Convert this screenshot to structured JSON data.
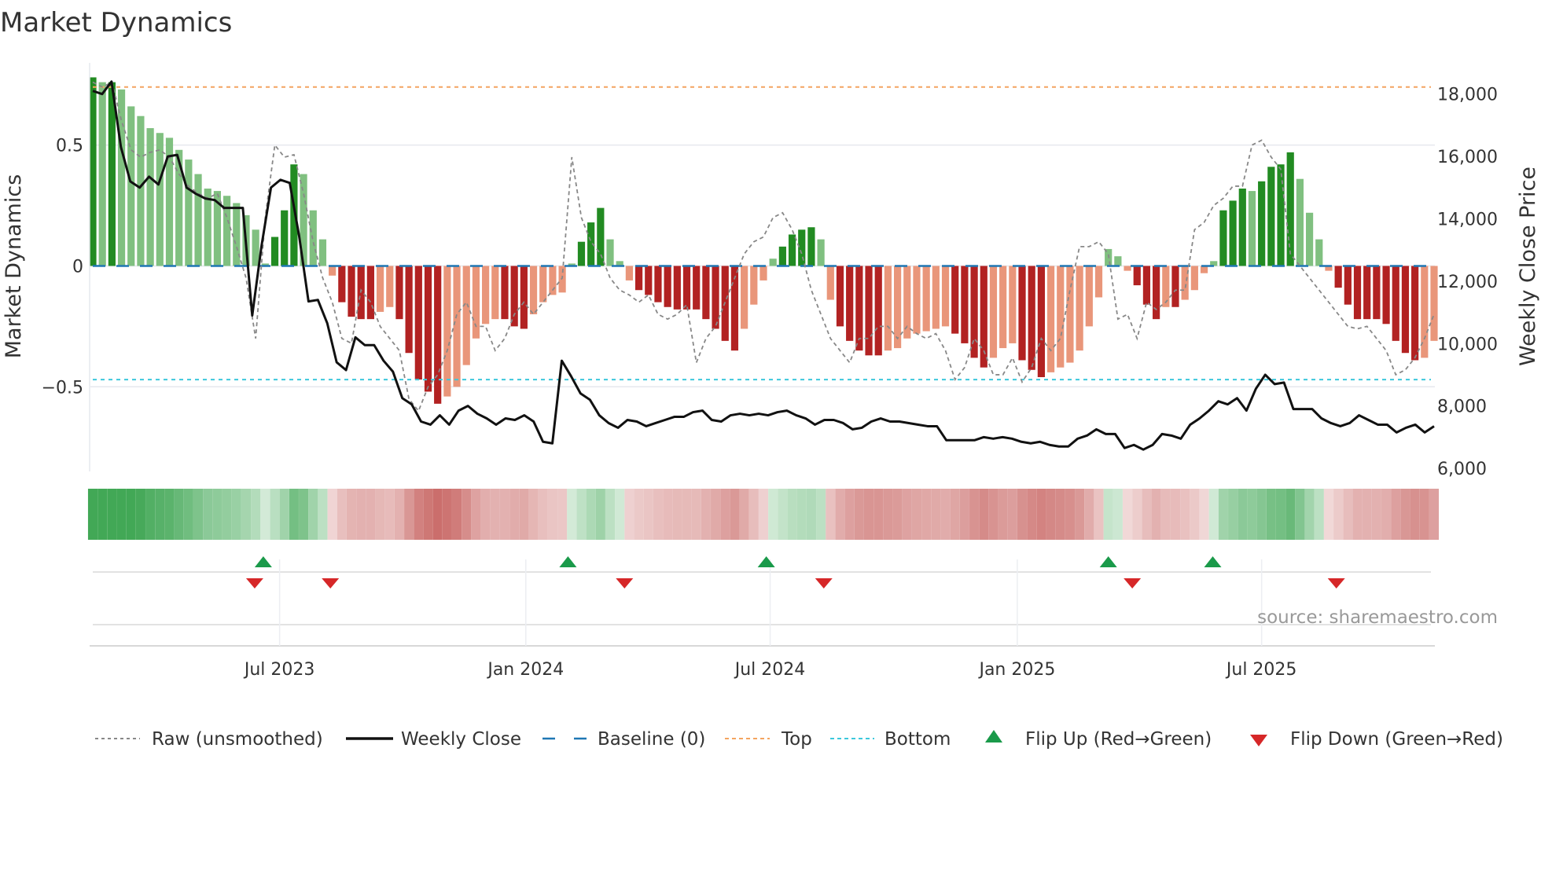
{
  "chart_data": {
    "type": "bar",
    "title": "Market Dynamics",
    "ylabel_left": "Market Dynamics",
    "ylabel_right": "Weekly Close Price",
    "ylim_left": [
      -0.85,
      0.84
    ],
    "ylim_right": [
      5900,
      19000
    ],
    "left_ticks": [
      {
        "v": 0.5,
        "label": "0.5"
      },
      {
        "v": 0,
        "label": "0"
      },
      {
        "v": -0.5,
        "label": "−0.5"
      }
    ],
    "right_ticks": [
      {
        "v": 18000,
        "label": "18,000"
      },
      {
        "v": 16000,
        "label": "16,000"
      },
      {
        "v": 14000,
        "label": "14,000"
      },
      {
        "v": 12000,
        "label": "12,000"
      },
      {
        "v": 10000,
        "label": "10,000"
      },
      {
        "v": 8000,
        "label": "8,000"
      },
      {
        "v": 6000,
        "label": "6,000"
      }
    ],
    "x_ticks": [
      {
        "i": 19.5,
        "label": "Jul 2023"
      },
      {
        "i": 45.2,
        "label": "Jan 2024"
      },
      {
        "i": 70.7,
        "label": "Jul 2024"
      },
      {
        "i": 96.5,
        "label": "Jan 2025"
      },
      {
        "i": 122,
        "label": "Jul 2025"
      }
    ],
    "top_level": 0.74,
    "bottom_level": -0.47,
    "baseline": 0,
    "momentum": [
      0.78,
      0.76,
      0.76,
      0.73,
      0.66,
      0.62,
      0.57,
      0.55,
      0.53,
      0.48,
      0.44,
      0.38,
      0.32,
      0.31,
      0.29,
      0.26,
      0.21,
      0.15,
      0.01,
      0.12,
      0.23,
      0.42,
      0.38,
      0.23,
      0.11,
      -0.04,
      -0.15,
      -0.21,
      -0.22,
      -0.22,
      -0.19,
      -0.17,
      -0.22,
      -0.36,
      -0.47,
      -0.52,
      -0.57,
      -0.54,
      -0.5,
      -0.41,
      -0.3,
      -0.24,
      -0.22,
      -0.22,
      -0.25,
      -0.26,
      -0.2,
      -0.15,
      -0.12,
      -0.11,
      0.01,
      0.1,
      0.18,
      0.24,
      0.11,
      0.02,
      -0.06,
      -0.1,
      -0.12,
      -0.15,
      -0.17,
      -0.18,
      -0.18,
      -0.18,
      -0.22,
      -0.26,
      -0.31,
      -0.35,
      -0.26,
      -0.16,
      -0.06,
      0.03,
      0.08,
      0.13,
      0.15,
      0.16,
      0.11,
      -0.14,
      -0.25,
      -0.31,
      -0.35,
      -0.37,
      -0.37,
      -0.35,
      -0.34,
      -0.3,
      -0.28,
      -0.27,
      -0.26,
      -0.25,
      -0.28,
      -0.32,
      -0.38,
      -0.42,
      -0.38,
      -0.34,
      -0.32,
      -0.39,
      -0.43,
      -0.46,
      -0.44,
      -0.42,
      -0.4,
      -0.35,
      -0.25,
      -0.13,
      0.07,
      0.04,
      -0.02,
      -0.08,
      -0.16,
      -0.22,
      -0.17,
      -0.17,
      -0.14,
      -0.1,
      -0.03,
      0.02,
      0.23,
      0.27,
      0.32,
      0.31,
      0.35,
      0.41,
      0.42,
      0.47,
      0.36,
      0.22,
      0.11,
      -0.02,
      -0.09,
      -0.16,
      -0.22,
      -0.22,
      -0.22,
      -0.24,
      -0.31,
      -0.36,
      -0.39,
      -0.38,
      -0.31
    ],
    "raw": [
      0.76,
      0.74,
      0.76,
      0.6,
      0.48,
      0.45,
      0.47,
      0.48,
      0.45,
      0.38,
      0.33,
      0.3,
      0.28,
      0.3,
      0.2,
      0.08,
      -0.05,
      -0.3,
      0.2,
      0.5,
      0.45,
      0.46,
      0.3,
      0.1,
      -0.05,
      -0.15,
      -0.3,
      -0.32,
      -0.1,
      -0.15,
      -0.25,
      -0.3,
      -0.35,
      -0.55,
      -0.6,
      -0.5,
      -0.45,
      -0.35,
      -0.2,
      -0.15,
      -0.25,
      -0.25,
      -0.35,
      -0.3,
      -0.2,
      -0.15,
      -0.2,
      -0.15,
      -0.1,
      -0.05,
      0.45,
      0.2,
      0.1,
      0.05,
      -0.05,
      -0.1,
      -0.12,
      -0.15,
      -0.12,
      -0.2,
      -0.22,
      -0.2,
      -0.16,
      -0.4,
      -0.3,
      -0.25,
      -0.15,
      -0.05,
      0.05,
      0.1,
      0.12,
      0.2,
      0.22,
      0.15,
      0.05,
      -0.1,
      -0.2,
      -0.3,
      -0.35,
      -0.4,
      -0.3,
      -0.3,
      -0.25,
      -0.25,
      -0.3,
      -0.25,
      -0.28,
      -0.3,
      -0.28,
      -0.35,
      -0.47,
      -0.42,
      -0.3,
      -0.35,
      -0.45,
      -0.45,
      -0.38,
      -0.48,
      -0.42,
      -0.3,
      -0.35,
      -0.3,
      -0.1,
      0.08,
      0.08,
      0.1,
      0.05,
      -0.22,
      -0.2,
      -0.3,
      -0.15,
      -0.18,
      -0.15,
      -0.1,
      -0.1,
      0.15,
      0.18,
      0.25,
      0.28,
      0.33,
      0.33,
      0.5,
      0.52,
      0.45,
      0.4,
      0.05,
      0.0,
      -0.05,
      -0.1,
      -0.15,
      -0.2,
      -0.25,
      -0.26,
      -0.25,
      -0.3,
      -0.35,
      -0.45,
      -0.43,
      -0.38,
      -0.3,
      -0.2
    ],
    "weekly_close": [
      18100,
      18000,
      18400,
      16300,
      15200,
      15000,
      15350,
      15100,
      16000,
      16050,
      15000,
      14800,
      14650,
      14600,
      14350,
      14350,
      14350,
      10900,
      13150,
      15000,
      15250,
      15150,
      13450,
      11350,
      11400,
      10650,
      9400,
      9150,
      10200,
      9950,
      9950,
      9450,
      9100,
      8250,
      8050,
      7500,
      7400,
      7700,
      7400,
      7850,
      8000,
      7750,
      7600,
      7400,
      7600,
      7550,
      7700,
      7500,
      6850,
      6800,
      9450,
      8950,
      8400,
      8200,
      7700,
      7450,
      7300,
      7550,
      7500,
      7350,
      7450,
      7550,
      7650,
      7650,
      7800,
      7850,
      7550,
      7500,
      7700,
      7750,
      7700,
      7750,
      7700,
      7800,
      7850,
      7700,
      7600,
      7400,
      7550,
      7550,
      7450,
      7250,
      7300,
      7500,
      7600,
      7500,
      7500,
      7450,
      7400,
      7350,
      7350,
      6900,
      6900,
      6900,
      6900,
      7000,
      6950,
      7000,
      6950,
      6850,
      6800,
      6850,
      6750,
      6700,
      6700,
      6950,
      7050,
      7250,
      7100,
      7100,
      6650,
      6750,
      6600,
      6750,
      7100,
      7050,
      6950,
      7400,
      7600,
      7850,
      8150,
      8050,
      8250,
      7850,
      8550,
      9000,
      8700,
      8750,
      7900,
      7900,
      7900,
      7600,
      7450,
      7350,
      7450,
      7700,
      7550,
      7400,
      7400,
      7150,
      7300,
      7400,
      7150,
      7350
    ],
    "flip_up": [
      17.8,
      49.6,
      70.3,
      106,
      116.9
    ],
    "flip_down": [
      16.9,
      24.8,
      55.5,
      76.3,
      108.5,
      129.8
    ],
    "annotation": "source: sharemaestro.com",
    "legend": [
      {
        "key": "raw",
        "label": "Raw (unsmoothed)"
      },
      {
        "key": "close",
        "label": "Weekly Close"
      },
      {
        "key": "baseline",
        "label": "Baseline (0)"
      },
      {
        "key": "top",
        "label": "Top"
      },
      {
        "key": "bottom",
        "label": "Bottom"
      },
      {
        "key": "up",
        "label": "Flip Up (Red→Green)"
      },
      {
        "key": "down",
        "label": "Flip Down (Green→Red)"
      }
    ],
    "legend_placement": "bottom"
  },
  "colors": {
    "dark_green": "#228b22",
    "light_green": "#80c080",
    "dark_red": "#b22222",
    "light_red": "#e9967a",
    "top": "#f4a460",
    "bottom": "#3cc8dc",
    "baseline": "#1f77b4",
    "raw": "#888888",
    "close": "#111111",
    "up": "#1a9a4a",
    "down": "#d62728"
  }
}
